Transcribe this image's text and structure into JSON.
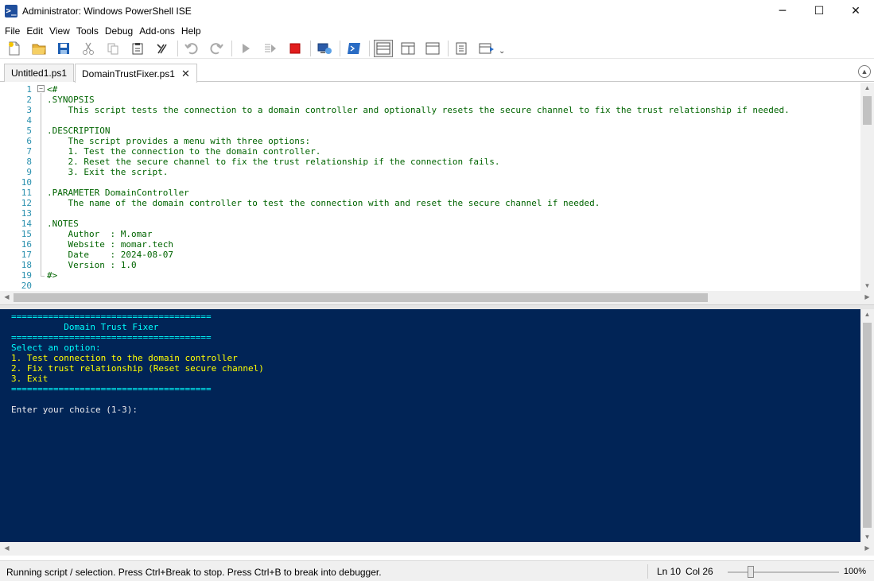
{
  "window": {
    "title": "Administrator: Windows PowerShell ISE",
    "minimize": "─",
    "maximize": "☐",
    "close": "✕"
  },
  "menu": [
    "File",
    "Edit",
    "View",
    "Tools",
    "Debug",
    "Add-ons",
    "Help"
  ],
  "toolbar": {
    "more": "⌄",
    "icons": [
      "new-file-icon",
      "open-folder-icon",
      "save-icon",
      "cut-icon",
      "copy-icon",
      "paste-icon",
      "clear-icon",
      "undo-icon",
      "redo-icon",
      "run-icon",
      "run-selection-icon",
      "stop-icon",
      "remote-icon",
      "powershell-icon",
      "layout-top-icon",
      "layout-right-icon",
      "layout-max-icon",
      "snippets-icon",
      "addon-icon"
    ]
  },
  "tabs": [
    {
      "label": "Untitled1.ps1",
      "active": false
    },
    {
      "label": "DomainTrustFixer.ps1",
      "active": true,
      "close": "✕"
    }
  ],
  "editor": {
    "line_numbers": [
      "1",
      "2",
      "3",
      "4",
      "5",
      "6",
      "7",
      "8",
      "9",
      "10",
      "11",
      "12",
      "13",
      "14",
      "15",
      "16",
      "17",
      "18",
      "19",
      "20"
    ],
    "lines": [
      "<#",
      ".SYNOPSIS",
      "    This script tests the connection to a domain controller and optionally resets the secure channel to fix the trust relationship if needed.",
      "",
      ".DESCRIPTION",
      "    The script provides a menu with three options:",
      "    1. Test the connection to the domain controller.",
      "    2. Reset the secure channel to fix the trust relationship if the connection fails.",
      "    3. Exit the script.",
      "",
      ".PARAMETER DomainController",
      "    The name of the domain controller to test the connection with and reset the secure channel if needed.",
      "",
      ".NOTES",
      "    Author  : M.omar",
      "    Website : momar.tech",
      "    Date    : 2024-08-07",
      "    Version : 1.0",
      "#>",
      ""
    ]
  },
  "console": {
    "lines": [
      {
        "text": "======================================",
        "color": "cyan"
      },
      {
        "text": "          Domain Trust Fixer",
        "color": "cyan"
      },
      {
        "text": "======================================",
        "color": "cyan"
      },
      {
        "text": "Select an option:",
        "color": "cyan"
      },
      {
        "text": "1. Test connection to the domain controller",
        "color": "yellow"
      },
      {
        "text": "2. Fix trust relationship (Reset secure channel)",
        "color": "yellow"
      },
      {
        "text": "3. Exit",
        "color": "yellow"
      },
      {
        "text": "======================================",
        "color": "cyan"
      },
      {
        "text": "",
        "color": "white"
      },
      {
        "text": "Enter your choice (1-3):",
        "color": "white"
      }
    ]
  },
  "status": {
    "message": "Running script / selection.  Press Ctrl+Break to stop.  Press Ctrl+B to break into debugger.",
    "line": "Ln 10",
    "col": "Col 26",
    "zoom": "100%",
    "zoom_level": 0.18
  },
  "colors": {
    "console_bg": "#012456",
    "console_cyan": "#00ffff",
    "console_yellow": "#ffff00",
    "editor_comment": "#006400",
    "line_number": "#2b91af"
  }
}
